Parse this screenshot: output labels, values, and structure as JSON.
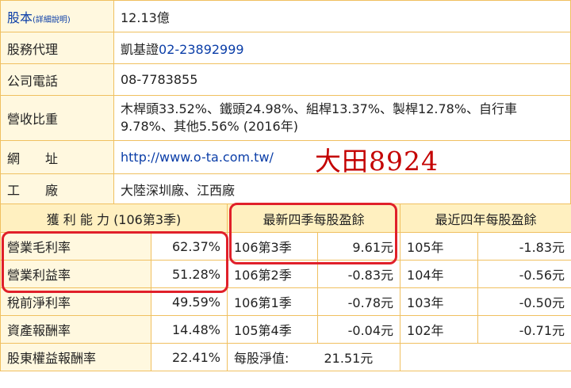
{
  "info": {
    "rows": [
      {
        "label": "股本",
        "label_link_note": "(詳細說明)",
        "value": "12.13億"
      },
      {
        "label": "股務代理",
        "value_text": "凱基證",
        "value_link": "02-23892999"
      },
      {
        "label": "公司電話",
        "value": "08-7783855"
      },
      {
        "label": "營收比重",
        "value_line1": "木桿頭33.52%、鐵頭24.98%、組桿13.37%、製桿12.78%、自行車",
        "value_line2": "9.78%、其他5.56% (2016年)"
      },
      {
        "label": "網　址",
        "value_link": "http://www.o-ta.com.tw/"
      },
      {
        "label": "工　廠",
        "value": "大陸深圳廠、江西廠"
      }
    ],
    "stamp": "大田8924"
  },
  "profit": {
    "header": "獲 利 能 力 (106第3季)",
    "rows": [
      {
        "name": "營業毛利率",
        "value": "62.37%"
      },
      {
        "name": "營業利益率",
        "value": "51.28%"
      },
      {
        "name": "稅前淨利率",
        "value": "49.59%"
      },
      {
        "name": "資產報酬率",
        "value": "14.48%"
      },
      {
        "name": "股東權益報酬率",
        "value": "22.41%"
      }
    ]
  },
  "eps4q": {
    "header": "最新四季每股盈餘",
    "rows": [
      {
        "period": "106第3季",
        "value": "9.61元"
      },
      {
        "period": "106第2季",
        "value": "-0.83元"
      },
      {
        "period": "106第1季",
        "value": "-0.78元"
      },
      {
        "period": "105第4季",
        "value": "-0.04元"
      }
    ],
    "nav_label": "每股淨值:",
    "nav_value": "21.51元"
  },
  "eps4y": {
    "header": "最近四年每股盈餘",
    "rows": [
      {
        "year": "105年",
        "value": "-1.83元"
      },
      {
        "year": "104年",
        "value": "-0.56元"
      },
      {
        "year": "103年",
        "value": "-0.50元"
      },
      {
        "year": "102年",
        "value": "-0.71元"
      }
    ]
  },
  "colors": {
    "border": "#f0c060",
    "header_bg": "#fff0c0",
    "label_bg": "#fff8df",
    "link": "#0b3ea8",
    "highlight": "#e0202a"
  }
}
